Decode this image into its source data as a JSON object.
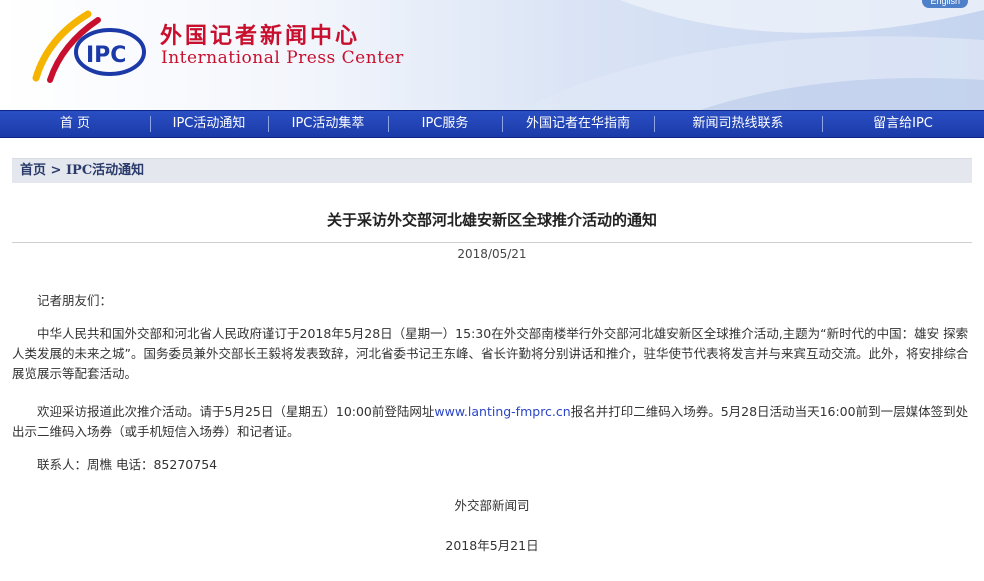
{
  "header": {
    "cn_title": "外国记者新闻中心",
    "en_title": "International Press Center",
    "logo_text": "IPC",
    "english_link": "English"
  },
  "nav": [
    {
      "label": "首 页"
    },
    {
      "label": "IPC活动通知"
    },
    {
      "label": "IPC活动集萃"
    },
    {
      "label": "IPC服务"
    },
    {
      "label": "外国记者在华指南"
    },
    {
      "label": "新闻司热线联系"
    },
    {
      "label": "留言给IPC"
    }
  ],
  "breadcrumb": {
    "home": "首页",
    "separator": " > ",
    "current": "IPC活动通知"
  },
  "article": {
    "title": "关于采访外交部河北雄安新区全球推介活动的通知",
    "date": "2018/05/21",
    "greeting": "记者朋友们：",
    "paragraph1": "中华人民共和国外交部和河北省人民政府谨订于2018年5月28日（星期一）15:30在外交部南楼举行外交部河北雄安新区全球推介活动,主题为“新时代的中国：雄安 探索人类发展的未来之城”。国务委员兼外交部长王毅将发表致辞，河北省委书记王东峰、省长许勤将分别讲话和推介，驻华使节代表将发言并与来宾互动交流。此外，将安排综合展览展示等配套活动。",
    "paragraph2_before": "欢迎采访报道此次推介活动。请于5月25日（星期五）10:00前登陆网址",
    "paragraph2_link": "www.lanting-fmprc.cn",
    "paragraph2_after": "报名并打印二维码入场券。5月28日活动当天16:00前到一层媒体签到处出示二维码入场券（或手机短信入场券）和记者证。",
    "contact": "联系人：周樵 电话：85270754",
    "signature": "外交部新闻司",
    "sign_date": "2018年5月21日"
  },
  "colors": {
    "brand_red": "#c8102e",
    "nav_blue": "#1f43b8",
    "link_blue": "#2a45c8"
  }
}
